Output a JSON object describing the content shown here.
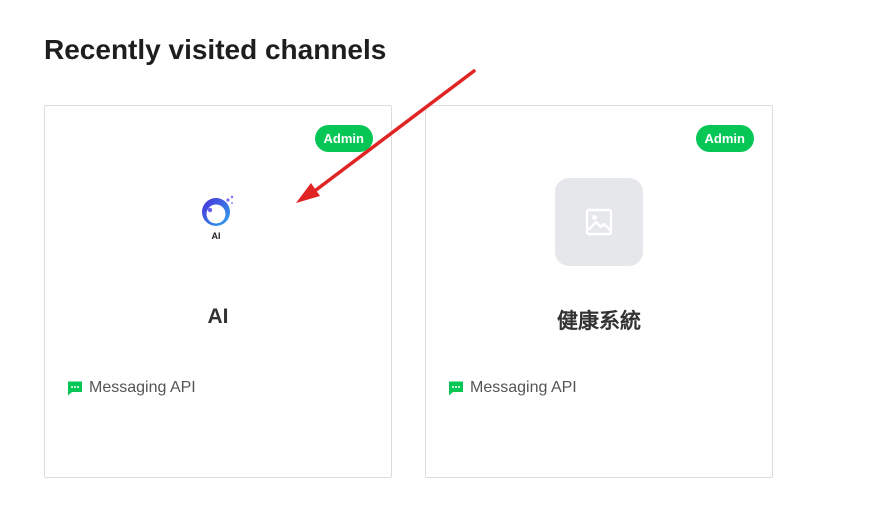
{
  "section": {
    "title": "Recently visited channels"
  },
  "channels": [
    {
      "name": "AI",
      "badge": "Admin",
      "type_label": "Messaging API",
      "logo_text": "AI"
    },
    {
      "name": "健康系統",
      "badge": "Admin",
      "type_label": "Messaging API"
    }
  ],
  "colors": {
    "badge": "#06c755",
    "annotation_arrow": "#e02424",
    "placeholder_bg": "#e6e7ea"
  },
  "icons": {
    "messaging_api": "chat-bubble-icon",
    "placeholder": "image-icon"
  }
}
